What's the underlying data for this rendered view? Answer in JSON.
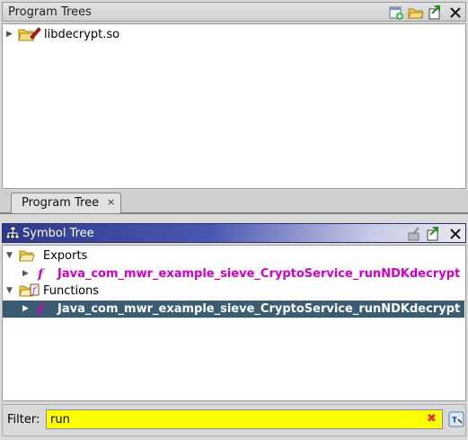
{
  "program_trees": {
    "title": "Program Trees",
    "root": {
      "label": "libdecrypt.so",
      "expanded": false
    },
    "tab": {
      "label": "Program Tree",
      "close": "×"
    }
  },
  "symbol_tree": {
    "title": "Symbol Tree",
    "groups": [
      {
        "label": "Exports",
        "expanded": true,
        "item": {
          "label": "Java_com_mwr_example_sieve_CryptoService_runNDKdecrypt",
          "selected": false
        }
      },
      {
        "label": "Functions",
        "expanded": true,
        "item": {
          "label": "Java_com_mwr_example_sieve_CryptoService_runNDKdecrypt",
          "selected": true
        }
      }
    ]
  },
  "filter": {
    "label": "Filter:",
    "value": "run"
  },
  "colors": {
    "function_name": "#d000c8",
    "selection": "#3a5d74",
    "filter_bg": "#ffff00",
    "header_accent": "#2e3a8c"
  },
  "icons": {
    "pt_header": [
      "new-view-icon",
      "open-folder-icon",
      "export-icon"
    ],
    "st_header": [
      "pin-icon",
      "export-icon",
      "close-icon"
    ],
    "function": "function-icon",
    "folder": "folder-icon",
    "filter_clear": "clear-icon",
    "filter_options": "filter-options-icon"
  }
}
